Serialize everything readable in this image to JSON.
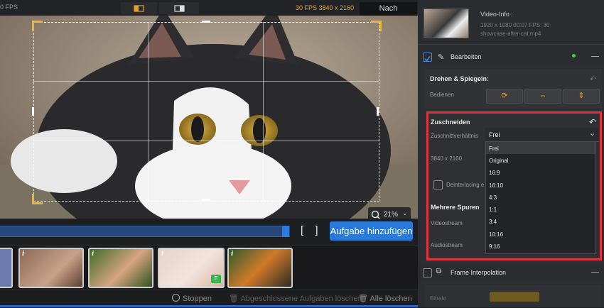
{
  "topbar": {
    "fps_left": "0 FPS",
    "fps_right": "30 FPS  3840 x 2160",
    "view_tab": "Nach"
  },
  "preview": {
    "zoom": "21%"
  },
  "timeline": {
    "add_task_label": "Aufgabe hinzufügen",
    "brackets": "[ ]"
  },
  "bottombar": {
    "stop_label": "Stoppen",
    "clear_done_label": "Abgeschlossene Aufgaben löschen",
    "clear_all_label": "Alle löschen"
  },
  "thumbs": {
    "badge": "i",
    "e_badge": "E"
  },
  "info": {
    "title": "Video-Info :",
    "meta": "1920 x 1080  00:07    FPS: 30",
    "filename": "showcase-after-cat.mp4"
  },
  "edit": {
    "label": "Bearbeiten"
  },
  "rotate": {
    "title": "Drehen & Spiegeln:",
    "operate_label": "Bedienen"
  },
  "crop": {
    "title": "Zuschneiden",
    "ratio_label": "Zuschnittverhältnis",
    "ratio_value": "Frei",
    "resolution": "3840 x 2160",
    "deinterlace": "Deinterlacing e",
    "options": [
      "Frei",
      "Original",
      "16:9",
      "16:10",
      "4:3",
      "1:1",
      "3:4",
      "10:16",
      "9:16"
    ]
  },
  "tracks": {
    "title": "Mehrere Spuren",
    "video_label": "Videostream",
    "audio_label": "Audiostream"
  },
  "interp": {
    "label": "Frame Interpolation",
    "bitrate_label": "Bitrate"
  },
  "colors": {
    "accent_orange": "#e3a22f",
    "highlight_red": "#e0353a",
    "blue": "#2979d9"
  }
}
